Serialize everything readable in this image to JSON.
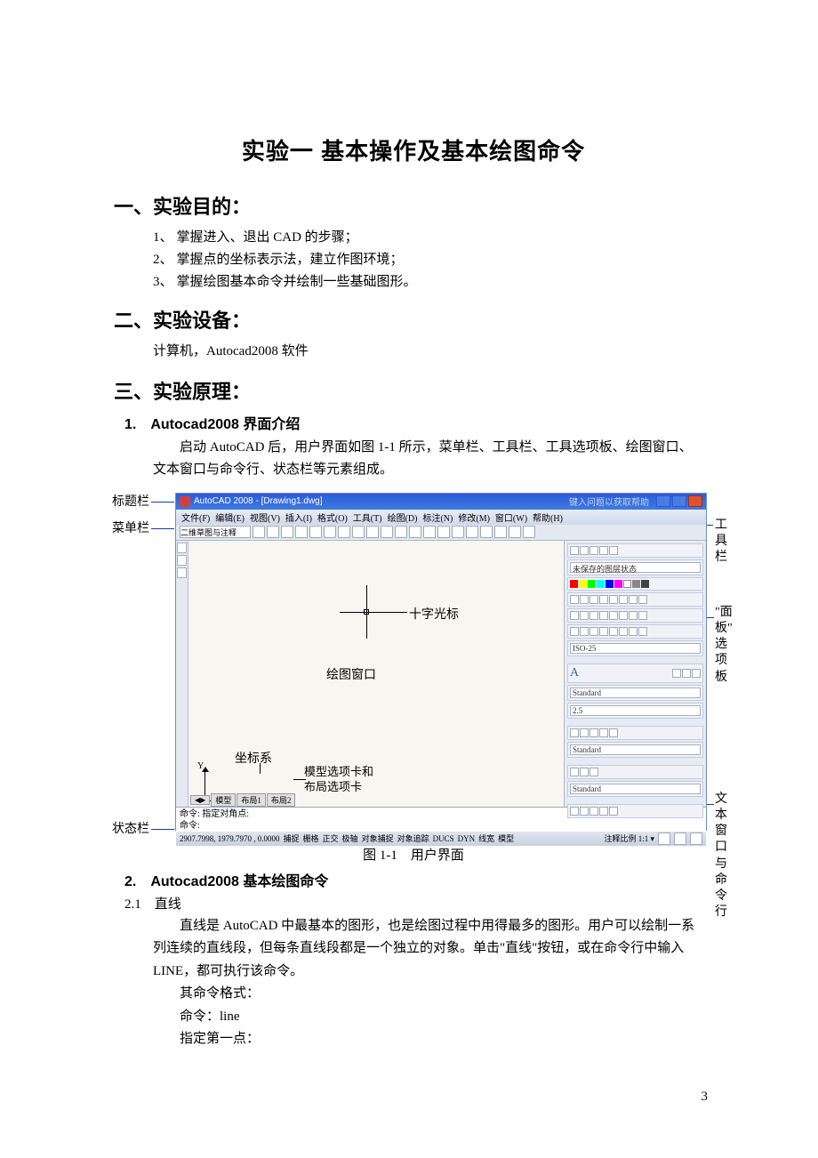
{
  "page_number": "3",
  "title": "实验一  基本操作及基本绘图命令",
  "sec1": {
    "heading": "一、实验目的：",
    "items": [
      "掌握进入、退出 CAD 的步骤；",
      "掌握点的坐标表示法，建立作图环境；",
      "掌握绘图基本命令并绘制一些基础图形。"
    ]
  },
  "sec2": {
    "heading": "二、实验设备：",
    "body": "计算机，Autocad2008 软件"
  },
  "sec3": {
    "heading": "三、实验原理：",
    "sub1": {
      "heading": "1.　Autocad2008 界面介绍",
      "body": "启动 AutoCAD 后，用户界面如图 1-1 所示，菜单栏、工具栏、工具选项板、绘图窗口、文本窗口与命令行、状态栏等元素组成。"
    },
    "sub2": {
      "heading": "2.　Autocad2008 基本绘图命令",
      "sub21_heading": "2.1　直线",
      "body": "直线是 AutoCAD 中最基本的图形，也是绘图过程中用得最多的图形。用户可以绘制一系列连续的直线段，但每条直线段都是一个独立的对象。单击\"直线\"按钮，或在命令行中输入 LINE，都可执行该命令。",
      "fmt": "其命令格式：",
      "cmd": "命令：line",
      "prompt": "指定第一点："
    }
  },
  "figure": {
    "caption": "图 1-1　用户界面",
    "callouts": {
      "titlebar": "标题栏",
      "menubar": "菜单栏",
      "toolbar": "工具栏",
      "panel": "\"面板\"\n选项板",
      "textwin": "文本窗口\n与命令行",
      "statusbar": "状态栏",
      "crosshair": "十字光标",
      "drawwin": "绘图窗口",
      "coord": "坐标系",
      "tabs1": "模型选项卡和",
      "tabs2": "布局选项卡"
    },
    "screenshot": {
      "title_text": "AutoCAD 2008 - [Drawing1.dwg]",
      "title_hint": "键入问题以获取帮助",
      "menu": [
        "文件(F)",
        "编辑(E)",
        "视图(V)",
        "插入(I)",
        "格式(O)",
        "工具(T)",
        "绘图(D)",
        "标注(N)",
        "修改(M)",
        "窗口(W)",
        "帮助(H)"
      ],
      "tb_dd": "二维草图与注释",
      "panel_labels": {
        "unsaved": "未保存的图层状态",
        "iso": "ISO-25",
        "standard": "Standard",
        "two5": "2.5"
      },
      "cmd_line1": "命令: 指定对角点:",
      "cmd_line2": "命令:",
      "status_left": "2907.7998, 1979.7970 , 0.0000",
      "status_btns": [
        "捕捉",
        "栅格",
        "正交",
        "极轴",
        "对象捕捉",
        "对象追踪",
        "DUCS",
        "DYN",
        "线宽",
        "模型"
      ],
      "status_right": "注释比例  1:1 ▾",
      "tabs": [
        "模型",
        "布局1",
        "布局2"
      ]
    }
  }
}
